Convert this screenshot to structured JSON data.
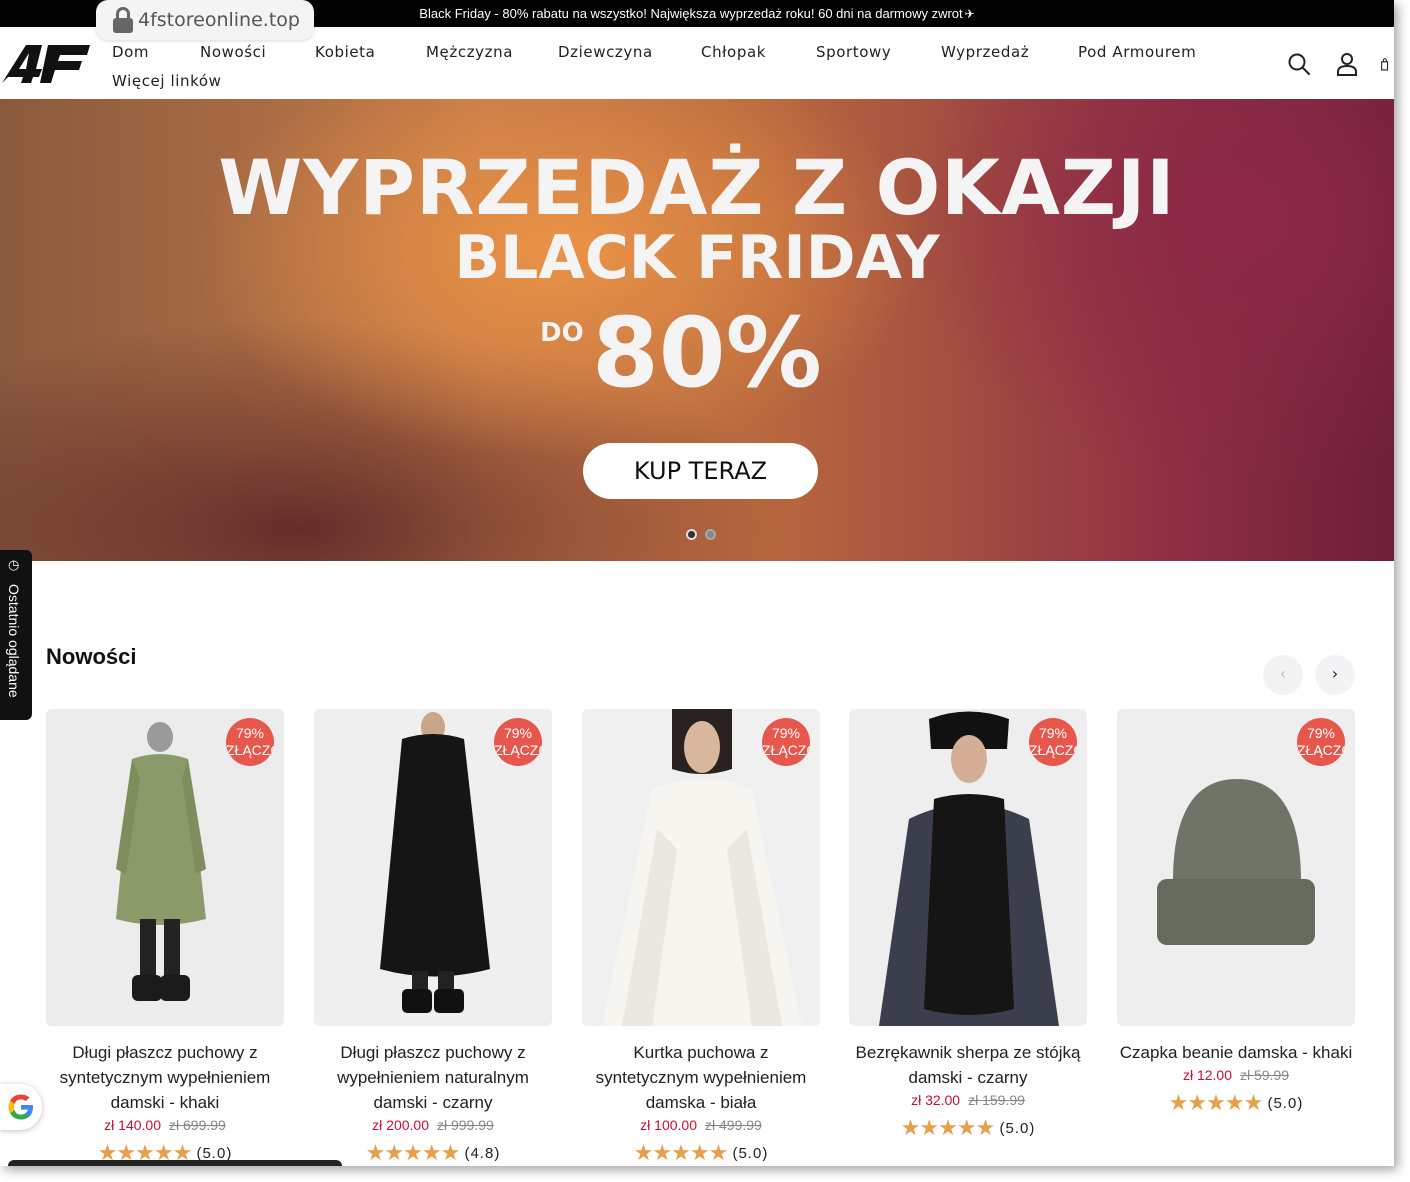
{
  "browser": {
    "url": "4fstoreonline.top"
  },
  "announcement": {
    "text": "Black Friday - 80% rabatu na wszystko! Największa wyprzedaż roku!  60 dni na darmowy zwrot",
    "icon": "airplane-icon"
  },
  "header": {
    "logo": "4F",
    "nav": [
      "Dom",
      "Nowości",
      "Kobieta",
      "Mężczyzna",
      "Dziewczyna",
      "Chłopak",
      "Sportowy",
      "Wyprzedaż",
      "Pod Armourem",
      "Więcej linków"
    ],
    "icons": [
      "search-icon",
      "account-icon",
      "cart-icon"
    ]
  },
  "hero": {
    "title": "WYPRZEDAŻ Z OKAZJI",
    "subtitle": "BLACK FRIDAY",
    "prefix": "DO",
    "percent": "80%",
    "button": "KUP TERAZ",
    "slides": 2,
    "active_slide": 1,
    "colors": {
      "orange": "#c57a48",
      "plum": "#8c2e44"
    }
  },
  "side_tab": {
    "label": "Ostatnio oglądane"
  },
  "section": {
    "title": "Nowości"
  },
  "products": [
    {
      "badge_pct": "79%",
      "badge_txt": "ZŁĄCZONE",
      "title": "Długi płaszcz puchowy z syntetycznym wypełnieniem damski - khaki",
      "price": "zł 140.00",
      "old_price": "zł 699.99",
      "rating": "(5.0)",
      "stars": 5
    },
    {
      "badge_pct": "79%",
      "badge_txt": "ZŁĄCZONE",
      "title": "Długi płaszcz puchowy z wypełnieniem naturalnym damski - czarny",
      "price": "zł 200.00",
      "old_price": "zł 999.99",
      "rating": "(4.8)",
      "stars": 5
    },
    {
      "badge_pct": "79%",
      "badge_txt": "ZŁĄCZONE",
      "title": "Kurtka puchowa z syntetycznym wypełnieniem damska - biała",
      "price": "zł 100.00",
      "old_price": "zł 499.99",
      "rating": "(5.0)",
      "stars": 5
    },
    {
      "badge_pct": "79%",
      "badge_txt": "ZŁĄCZONE",
      "title": "Bezrękawnik sherpa ze stójką damski - czarny",
      "price": "zł 32.00",
      "old_price": "zł 159.99",
      "rating": "(5.0)",
      "stars": 5
    },
    {
      "badge_pct": "79%",
      "badge_txt": "ZŁĄCZONE",
      "title": "Czapka beanie damska - khaki",
      "price": "zł 12.00",
      "old_price": "zł 59.99",
      "rating": "(5.0)",
      "stars": 5
    }
  ],
  "colors": {
    "sale_red": "#c8102e",
    "badge": "#e8574c",
    "star": "#e8a04a"
  }
}
